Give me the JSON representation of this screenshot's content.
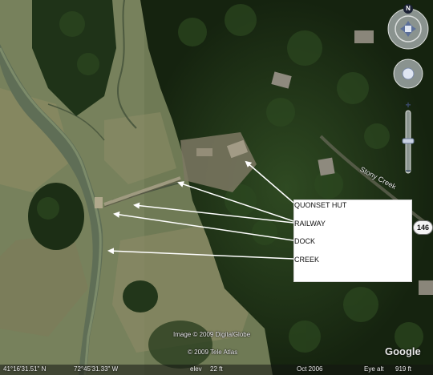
{
  "map": {
    "labels": [
      {
        "id": "quonset",
        "text": "QUONSET HUT"
      },
      {
        "id": "railway",
        "text": "RAILWAY"
      },
      {
        "id": "dock",
        "text": "DOCK"
      },
      {
        "id": "creek",
        "text": "CREEK"
      }
    ],
    "road_name": "Stony Creek",
    "route_shield": "146",
    "credits": {
      "imagery": "Image © 2009 DigitalGlobe",
      "tele_atlas": "© 2009 Tele Atlas"
    },
    "logo": "Google"
  },
  "navigation": {
    "compass_letter": "N",
    "zoom_in_symbol": "+",
    "zoom_out_symbol": "−"
  },
  "status_bar": {
    "latitude": "41°16'31.51\" N",
    "longitude": "72°45'31.33\" W",
    "elevation_label": "elev",
    "elevation_value": "22 ft",
    "imagery_date": "Oct 2006",
    "eye_alt_label": "Eye alt",
    "eye_alt_value": "919 ft"
  }
}
